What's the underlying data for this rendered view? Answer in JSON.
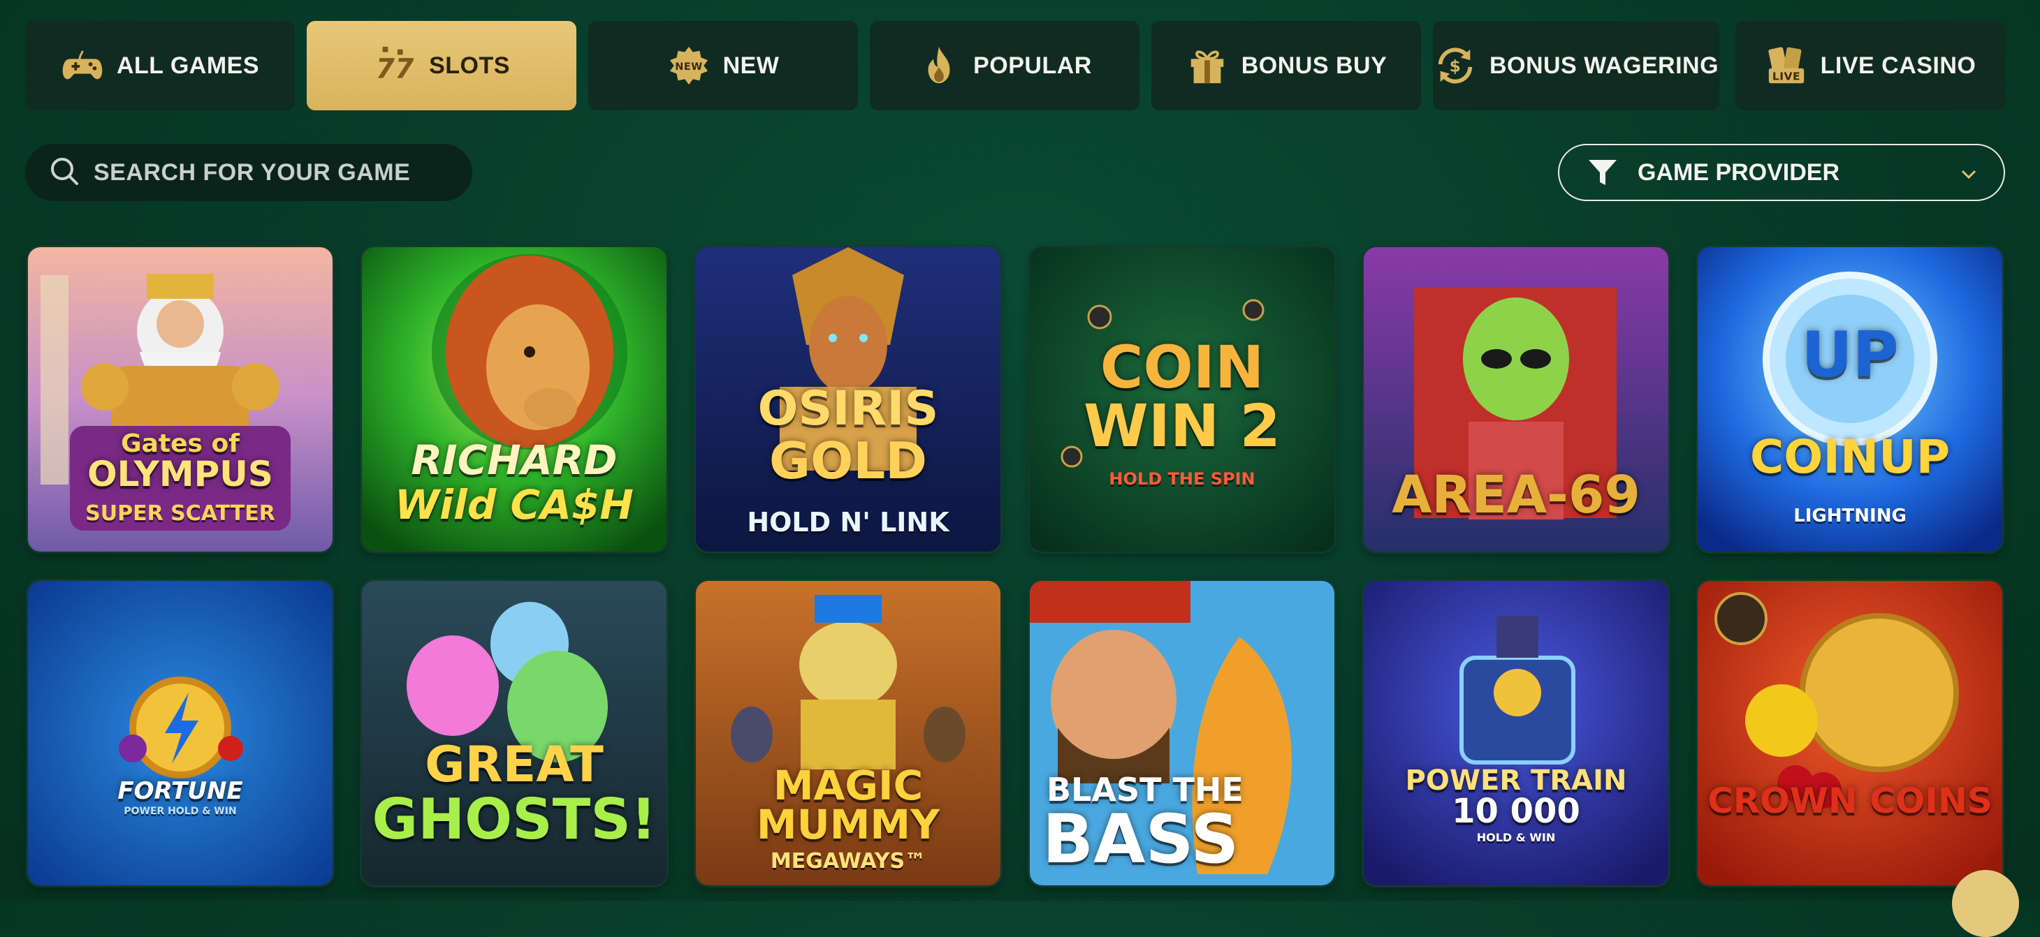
{
  "tabs": [
    {
      "label": "ALL GAMES",
      "icon": "gamepad-icon"
    },
    {
      "label": "SLOTS",
      "icon": "slots-777-icon",
      "active": true
    },
    {
      "label": "NEW",
      "icon": "new-badge-icon"
    },
    {
      "label": "POPULAR",
      "icon": "flame-icon"
    },
    {
      "label": "BONUS BUY",
      "icon": "gift-icon"
    },
    {
      "label": "BONUS WAGERING",
      "icon": "dollar-cycle-icon"
    },
    {
      "label": "LIVE CASINO",
      "icon": "live-cards-icon"
    }
  ],
  "search": {
    "placeholder": "SEARCH FOR YOUR GAME",
    "icon": "search-icon"
  },
  "provider_filter": {
    "label": "GAME PROVIDER",
    "icon": "funnel-icon",
    "chevron": "chevron-down-icon"
  },
  "games": [
    {
      "line1": "Gates of",
      "line2": "OLYMPUS",
      "line3": "SUPER SCATTER"
    },
    {
      "line1": "RICHARD",
      "line2": "Wild CA$H",
      "line3": ""
    },
    {
      "line1": "OSIRIS",
      "line2": "GOLD",
      "line3": "HOLD N' LINK"
    },
    {
      "line1": "COIN",
      "line2": "WIN 2",
      "line3": "HOLD THE SPIN"
    },
    {
      "line1": "AREA-69",
      "line2": "",
      "line3": ""
    },
    {
      "line1": "UP",
      "line2": "COINUP",
      "line3": "LIGHTNING"
    },
    {
      "line1": "FORTUNE",
      "line2": "POWER HOLD & WIN",
      "line3": ""
    },
    {
      "line1": "GREAT",
      "line2": "GHOSTS!",
      "line3": ""
    },
    {
      "line1": "MAGIC",
      "line2": "MUMMY",
      "line3": "MEGAWAYS™"
    },
    {
      "line1": "BLAST THE",
      "line2": "BASS",
      "line3": ""
    },
    {
      "line1": "POWER TRAIN",
      "line2": "10 000",
      "line3": "HOLD & WIN"
    },
    {
      "line1": "CROWN COINS",
      "line2": "",
      "line3": ""
    }
  ],
  "colors": {
    "active_tab": "#e0bd68",
    "tab_bg": "#0f3327",
    "page_bg": "#073a28"
  }
}
